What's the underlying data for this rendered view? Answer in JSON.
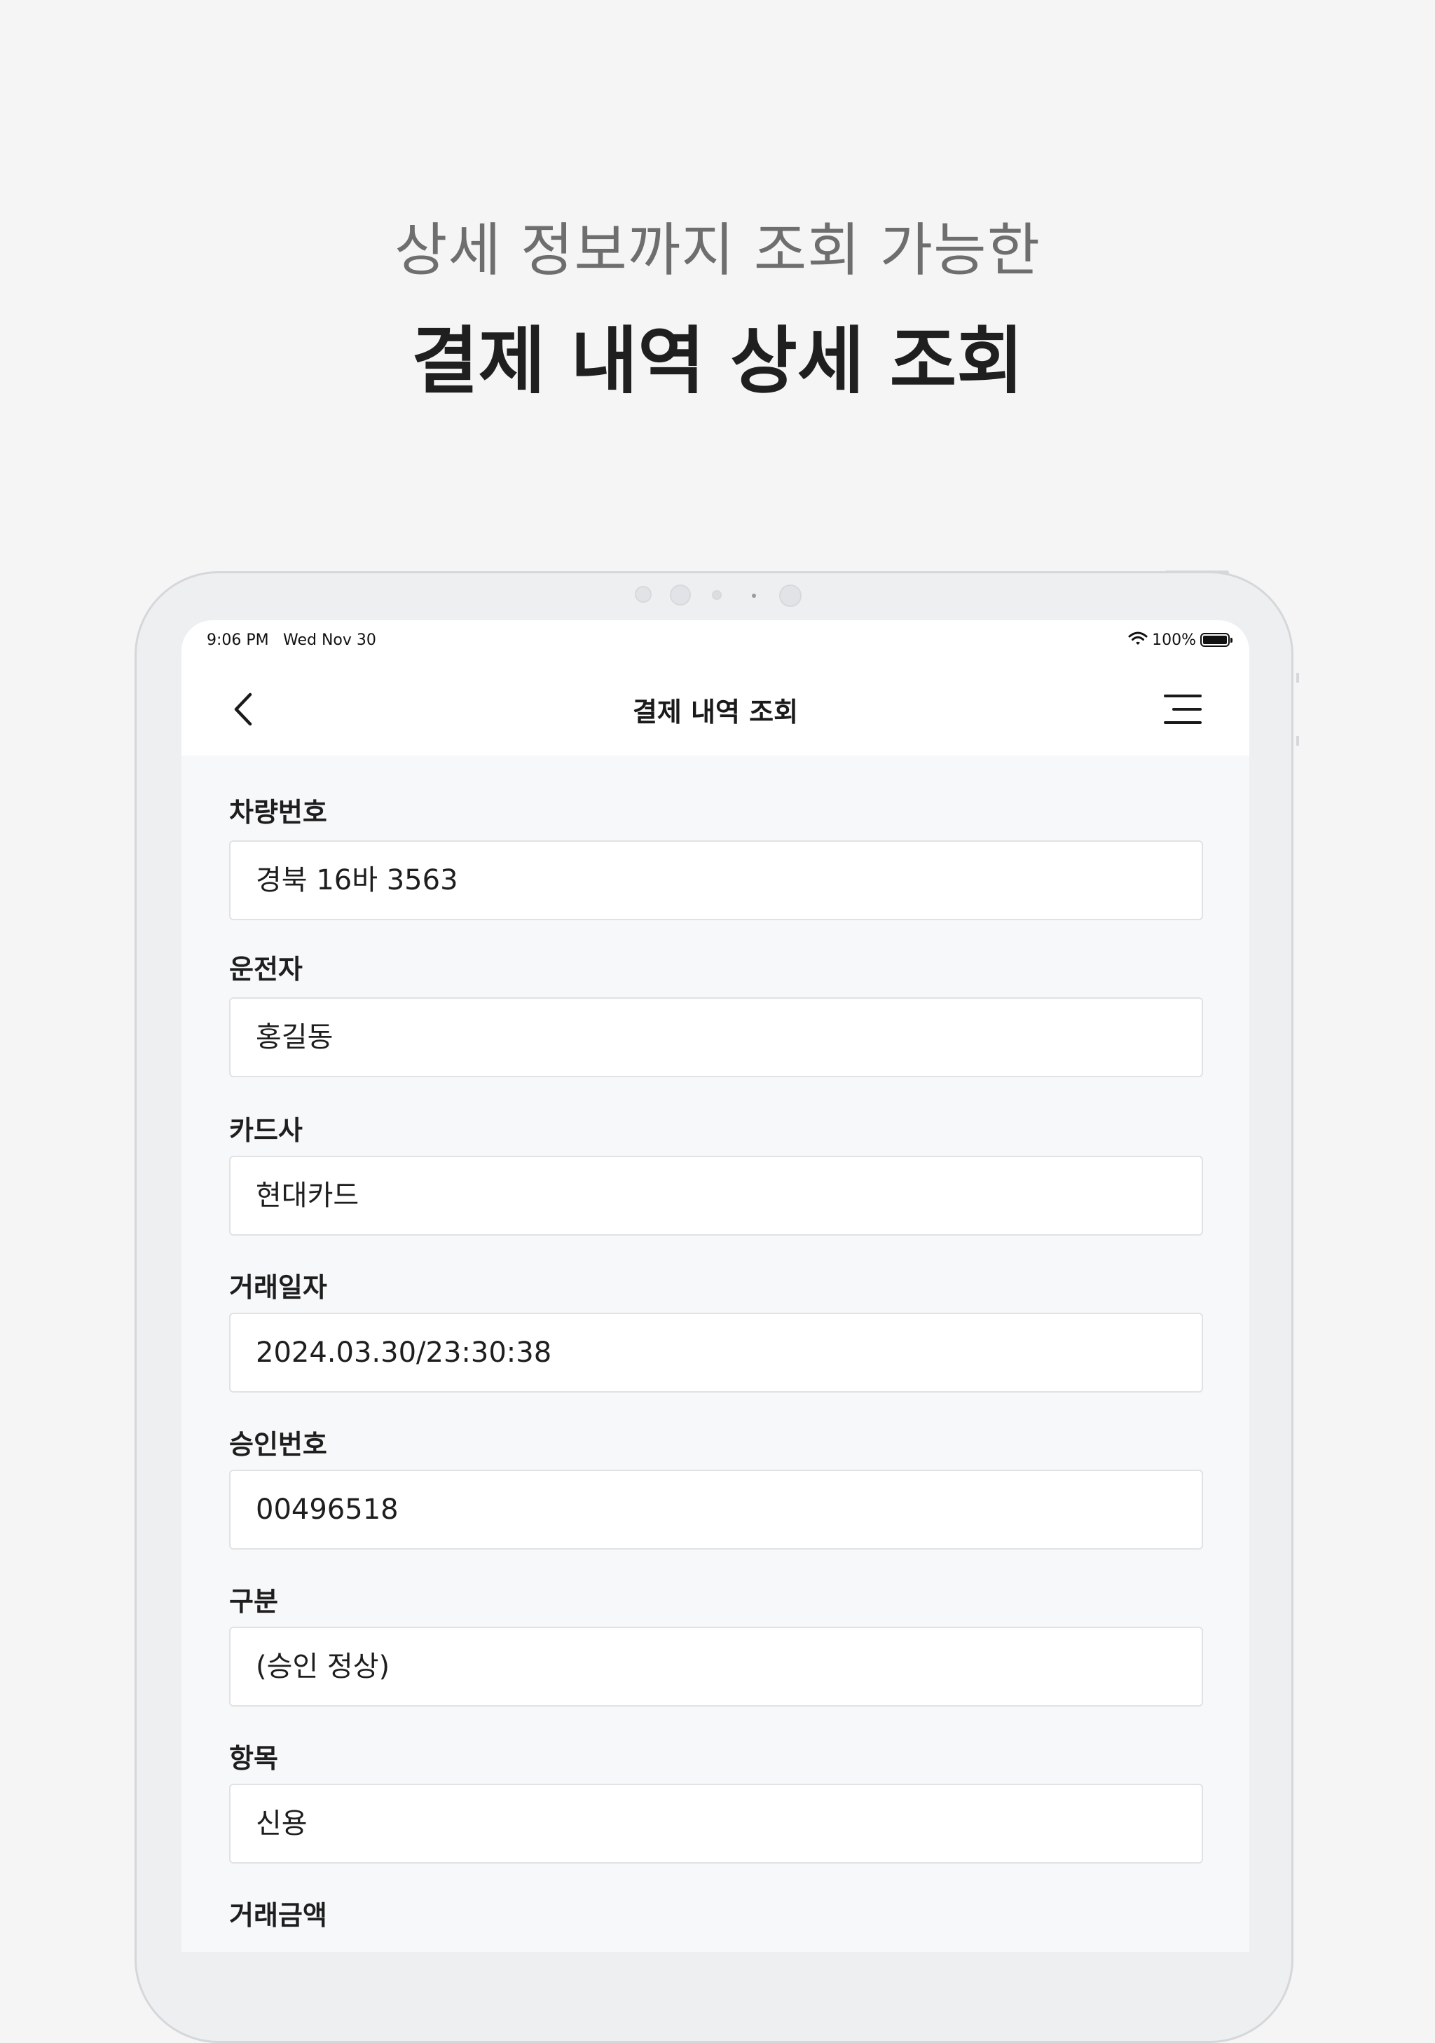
{
  "promo": {
    "subtitle": "상세 정보까지 조회 가능한",
    "title": "결제 내역 상세 조회"
  },
  "status_bar": {
    "time": "9:06 PM",
    "date": "Wed Nov 30",
    "battery": "100%"
  },
  "nav": {
    "title": "결제 내역 조회",
    "back_icon": "chevron-left-icon",
    "menu_icon": "menu-icon"
  },
  "fields": [
    {
      "label": "차량번호",
      "value": "경북 16바 3563"
    },
    {
      "label": "운전자",
      "value": "홍길동"
    },
    {
      "label": "카드사",
      "value": "현대카드"
    },
    {
      "label": "거래일자",
      "value": "2024.03.30/23:30:38"
    },
    {
      "label": "승인번호",
      "value": "00496518"
    },
    {
      "label": "구분",
      "value": "(승인 정상)"
    },
    {
      "label": "항목",
      "value": "신용"
    },
    {
      "label": "거래금액",
      "value": ""
    }
  ]
}
